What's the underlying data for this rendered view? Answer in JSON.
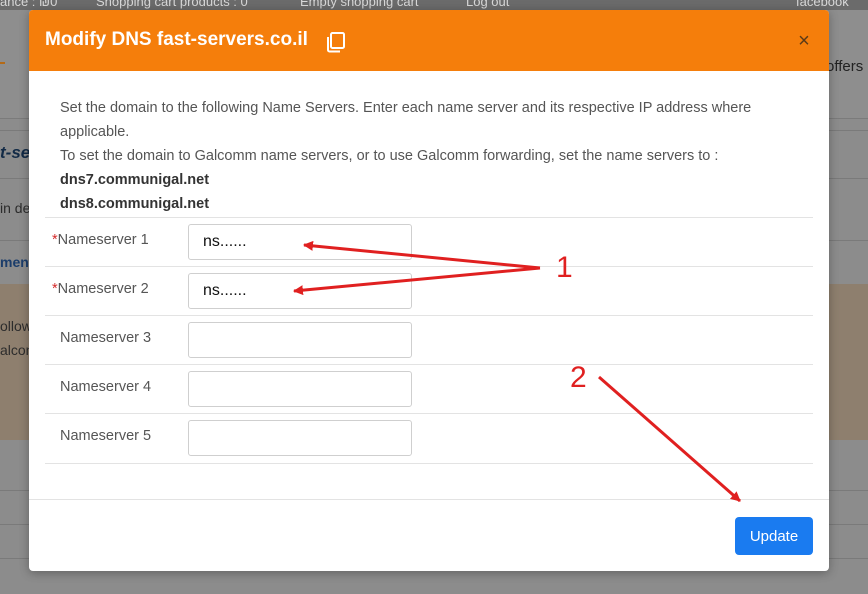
{
  "background": {
    "topbar": {
      "balance": "ance : ₪0",
      "cart_products": "Shopping cart products : 0",
      "empty_cart": "Empty shopping cart",
      "logout": "Log out",
      "facebook": "facebook"
    },
    "offers": "offers",
    "title_fragment": "t-se",
    "text_fragment_1": "in de",
    "text_fragment_2": "ment",
    "text_fragment_3": "ollow",
    "text_fragment_4": "alcon"
  },
  "modal": {
    "title": "Modify DNS fast-servers.co.il",
    "close_label": "×",
    "intro_line_1": "Set the domain to the following Name Servers. Enter each name server and its respective IP address where applicable.",
    "intro_line_2": "To set the domain to Galcomm name servers, or to use Galcomm forwarding, set the name servers to :",
    "default_ns_1": "dns7.communigal.net",
    "default_ns_2": "dns8.communigal.net",
    "required_mark": "*",
    "nameservers": [
      {
        "label": "Nameserver 1",
        "value": "ns......",
        "required": true
      },
      {
        "label": "Nameserver 2",
        "value": "ns......",
        "required": true
      },
      {
        "label": "Nameserver 3",
        "value": "",
        "required": false
      },
      {
        "label": "Nameserver 4",
        "value": "",
        "required": false
      },
      {
        "label": "Nameserver 5",
        "value": "",
        "required": false
      }
    ],
    "update_label": "Update"
  },
  "annotations": {
    "step_1": "1",
    "step_2": "2"
  },
  "colors": {
    "header": "#f57e0b",
    "update_button": "#1a7bf0",
    "annotation": "#e02020",
    "required": "#d42a2a"
  }
}
